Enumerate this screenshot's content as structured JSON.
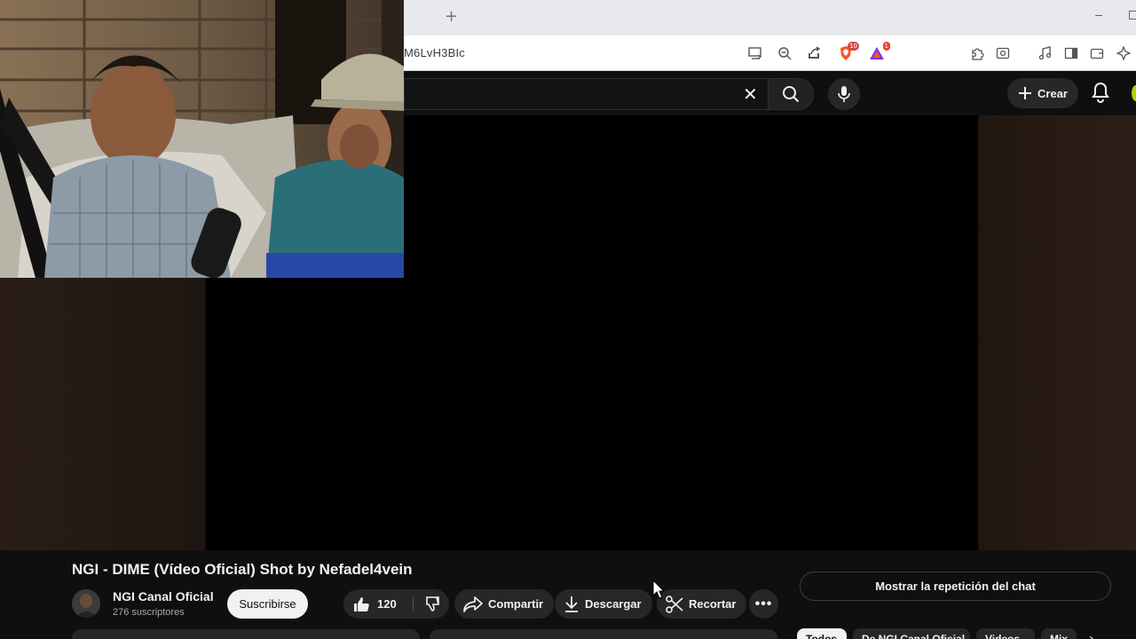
{
  "browser": {
    "new_tab_glyph": "+",
    "url": "M6LvH3BIc",
    "minimize_glyph": "–"
  },
  "yt_header": {
    "clear_glyph": "✕",
    "create_label": "Crear"
  },
  "video": {
    "title": "NGI - DIME (Vídeo Oficial) Shot by Nefadel4vein"
  },
  "channel": {
    "name": "NGI Canal Oficial",
    "subscribers": "276 suscriptores",
    "subscribe_label": "Suscribirse"
  },
  "actions": {
    "likes": "120",
    "share_label": "Compartir",
    "download_label": "Descargar",
    "clip_label": "Recortar",
    "more_glyph": "•••"
  },
  "chat": {
    "replay_label": "Mostrar la repetición del chat"
  },
  "chips": [
    {
      "label": "Todos"
    },
    {
      "label": "De NGI Canal Oficial"
    },
    {
      "label": "Videos"
    },
    {
      "label": "Mix"
    }
  ],
  "chips_arrow": "›",
  "colors": {
    "page_bg": "#0f0f0f",
    "pill_bg": "#272727",
    "accent_avatar": "#a8d400"
  }
}
